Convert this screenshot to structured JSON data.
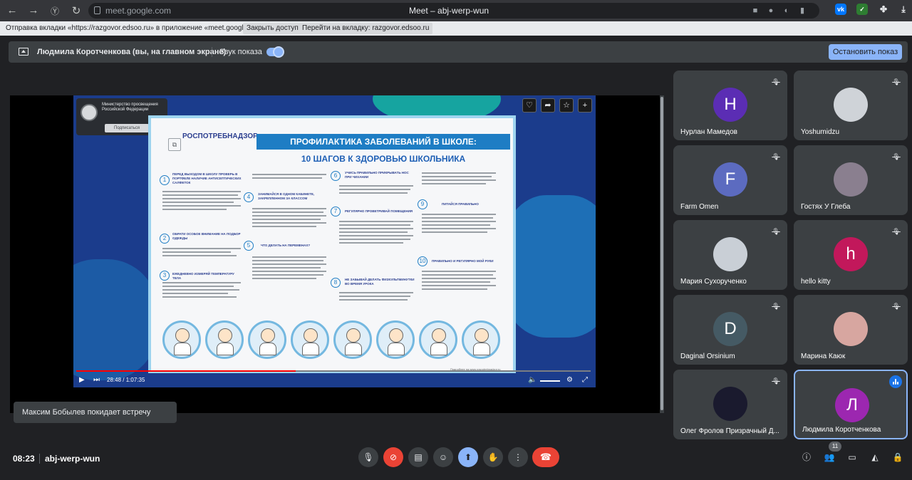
{
  "browser": {
    "url": "meet.google.com",
    "tab_title": "Meet – abj-werp-wun"
  },
  "share_notice": {
    "message": "Отправка вкладки «https://razgovor.edsoo.ru» в приложение «meet.google.com»...",
    "stop_label": "Закрыть доступ",
    "switch_label": "Перейти на вкладку: razgovor.edsoo.ru"
  },
  "presenting": {
    "text": "Людмила Коротченкова (вы, на главном экране)",
    "sound_label": "Звук показа",
    "sound_on": true,
    "stop_label": "Остановить показ"
  },
  "video": {
    "ministry": "Министерство просвещения Российской Федерации",
    "subscribe_label": "Подписаться",
    "poster": {
      "org": "РОСПОТРЕБНАДЗОР",
      "title": "ПРОФИЛАКТИКА ЗАБОЛЕВАНИЙ В ШКОЛЕ:",
      "subtitle": "10 ШАГОВ К ЗДОРОВЬЮ ШКОЛЬНИКА",
      "steps": [
        {
          "n": "1",
          "title": "ПЕРЕД ВЫХОДОМ В ШКОЛУ ПРОВЕРЬ В ПОРТФЕЛЕ НАЛИЧИЕ АНТИСЕПТИЧЕСКИХ САЛФЕТОК"
        },
        {
          "n": "2",
          "title": "ОБРАТИ ОСОБОЕ ВНИМАНИЕ НА ПОДБОР ОДЕЖДЫ"
        },
        {
          "n": "3",
          "title": "ЕЖЕДНЕВНО ИЗМЕРЯЙ ТЕМПЕРАТУРУ ТЕЛА"
        },
        {
          "n": "4",
          "title": "ЗАНИМАЙСЯ В ОДНОМ КАБИНЕТЕ, ЗАКРЕПЛЕННОМ ЗА КЛАССОМ"
        },
        {
          "n": "5",
          "title": "ЧТО ДЕЛАТЬ НА ПЕРЕМЕНАХ?"
        },
        {
          "n": "6",
          "title": "УЧИСЬ ПРАВИЛЬНО ПРИКРЫВАТЬ НОС ПРИ ЧИХАНИИ"
        },
        {
          "n": "7",
          "title": "РЕГУЛЯРНО ПРОВЕТРИВАЙ ПОМЕЩЕНИЯ"
        },
        {
          "n": "8",
          "title": "НЕ ЗАБЫВАЙ ДЕЛАТЬ ФИЗКУЛЬТМИНУТКИ ВО ВРЕМЯ УРОКА"
        },
        {
          "n": "9",
          "title": "ПИТАЙСЯ ПРАВИЛЬНО"
        },
        {
          "n": "10",
          "title": "ПРАВИЛЬНО И РЕГУЛЯРНО МОЙ РУКИ"
        }
      ],
      "footer": "Подробнее на www.rospotrebnadzor.ru"
    },
    "time_current": "28:48",
    "time_total": "1:07:35",
    "progress_fraction": 0.426
  },
  "toast": "Максим Бобылев покидает встречу",
  "participants": [
    {
      "name": "Нурлан Мамедов",
      "initial": "Н",
      "color": "#5b2db4",
      "muted": true,
      "photo": false
    },
    {
      "name": "Yoshumidzu",
      "initial": "",
      "color": "#cfd3d8",
      "muted": true,
      "photo": true
    },
    {
      "name": "Farm Omen",
      "initial": "F",
      "color": "#5c6bc0",
      "muted": true,
      "photo": false
    },
    {
      "name": "Гостях У Глеба",
      "initial": "",
      "color": "#8a7f8f",
      "muted": true,
      "photo": true
    },
    {
      "name": "Мария Сухорученко",
      "initial": "",
      "color": "#c9cfd6",
      "muted": true,
      "photo": true
    },
    {
      "name": "hello kitty",
      "initial": "h",
      "color": "#c2185b",
      "muted": true,
      "photo": false
    },
    {
      "name": "Daginal Orsinium",
      "initial": "D",
      "color": "#455a64",
      "muted": true,
      "photo": false
    },
    {
      "name": "Марина Каюк",
      "initial": "",
      "color": "#d7a6a0",
      "muted": true,
      "photo": true
    },
    {
      "name": "Олег Фролов Призрачный Д...",
      "initial": "",
      "color": "#1a1a2e",
      "muted": true,
      "photo": true
    },
    {
      "name": "Людмила Коротченкова",
      "initial": "Л",
      "color": "#9c27b0",
      "muted": false,
      "photo": false,
      "speaking": true
    }
  ],
  "bottom": {
    "time": "08:23",
    "meeting_code": "abj-werp-wun",
    "participant_count": "11"
  }
}
